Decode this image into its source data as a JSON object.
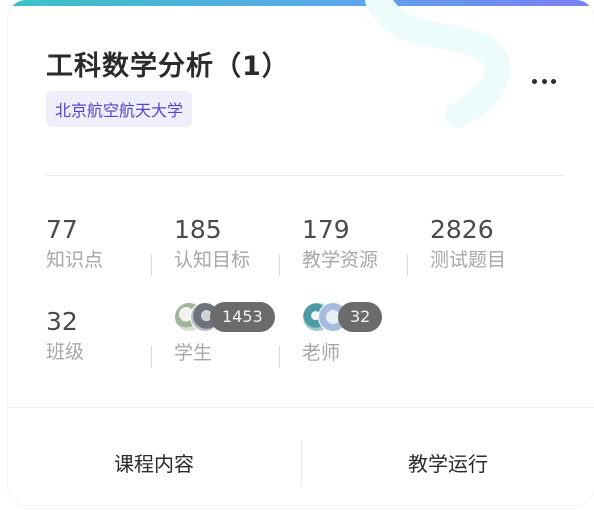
{
  "course": {
    "title": "工科数学分析（1）",
    "school": "北京航空航天大学"
  },
  "stats": {
    "knowledge_points": {
      "value": "77",
      "label": "知识点"
    },
    "cognitive_goals": {
      "value": "185",
      "label": "认知目标"
    },
    "teaching_resources": {
      "value": "179",
      "label": "教学资源"
    },
    "test_questions": {
      "value": "2826",
      "label": "测试题目"
    },
    "classes": {
      "value": "32",
      "label": "班级"
    }
  },
  "people": {
    "students": {
      "count": "1453",
      "label": "学生"
    },
    "teachers": {
      "count": "32",
      "label": "老师"
    }
  },
  "actions": {
    "course_content": "课程内容",
    "teaching_operation": "教学运行"
  },
  "icons": {
    "more": "more-dots-icon"
  },
  "colors": {
    "accent_gradient_start": "#3cc2c7",
    "accent_gradient_end": "#7b7ff2",
    "tag_background": "#efeefd",
    "tag_text": "#5348c9",
    "label_gray": "#a7a7a7"
  }
}
